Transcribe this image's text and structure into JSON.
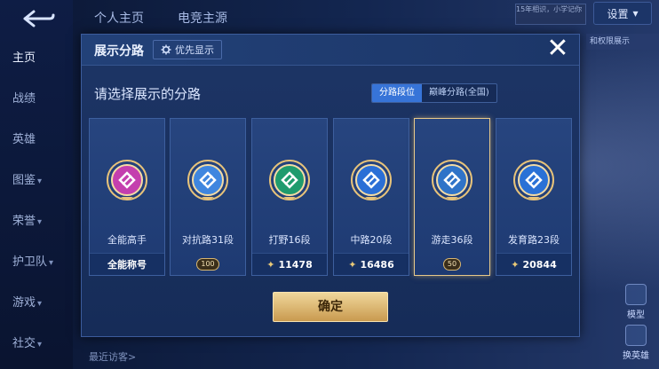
{
  "background": {
    "top_tabs": [
      "个人主页",
      "电竞主源"
    ],
    "settings_label": "设置",
    "notice_text": "15年相识，小学记你",
    "right_hint": "和权限展示",
    "sidebar": [
      {
        "label": "主页",
        "chevron": false
      },
      {
        "label": "战绩",
        "chevron": false
      },
      {
        "label": "英雄",
        "chevron": false
      },
      {
        "label": "图鉴",
        "chevron": true
      },
      {
        "label": "荣誉",
        "chevron": true
      },
      {
        "label": "护卫队",
        "chevron": true
      },
      {
        "label": "游戏",
        "chevron": true
      },
      {
        "label": "社交",
        "chevron": true
      }
    ],
    "right_buttons": [
      "模型",
      "换英雄"
    ],
    "bottom_text": "最近访客>"
  },
  "modal": {
    "title": "展示分路",
    "priority_label": "优先显示",
    "prompt": "请选择展示的分路",
    "toggle": [
      "分路段位",
      "巅峰分路(全国)"
    ],
    "confirm_label": "确定"
  },
  "cards": [
    {
      "role": "全能高手",
      "footer": "全能称号",
      "footer_type": "text",
      "emblem_color": "#c43fae",
      "selected": false
    },
    {
      "role": "对抗路31段",
      "footer": "100",
      "footer_type": "rank",
      "emblem_color": "#3f86df",
      "selected": false
    },
    {
      "role": "打野16段",
      "footer": "11478",
      "footer_type": "score",
      "emblem_color": "#1f9b6d",
      "selected": false
    },
    {
      "role": "中路20段",
      "footer": "16486",
      "footer_type": "score",
      "emblem_color": "#2b6fd6",
      "selected": false
    },
    {
      "role": "游走36段",
      "footer": "50",
      "footer_type": "rank",
      "emblem_color": "#2f73c8",
      "selected": true
    },
    {
      "role": "发育路23段",
      "footer": "20844",
      "footer_type": "score",
      "emblem_color": "#2a71d6",
      "selected": false
    }
  ]
}
